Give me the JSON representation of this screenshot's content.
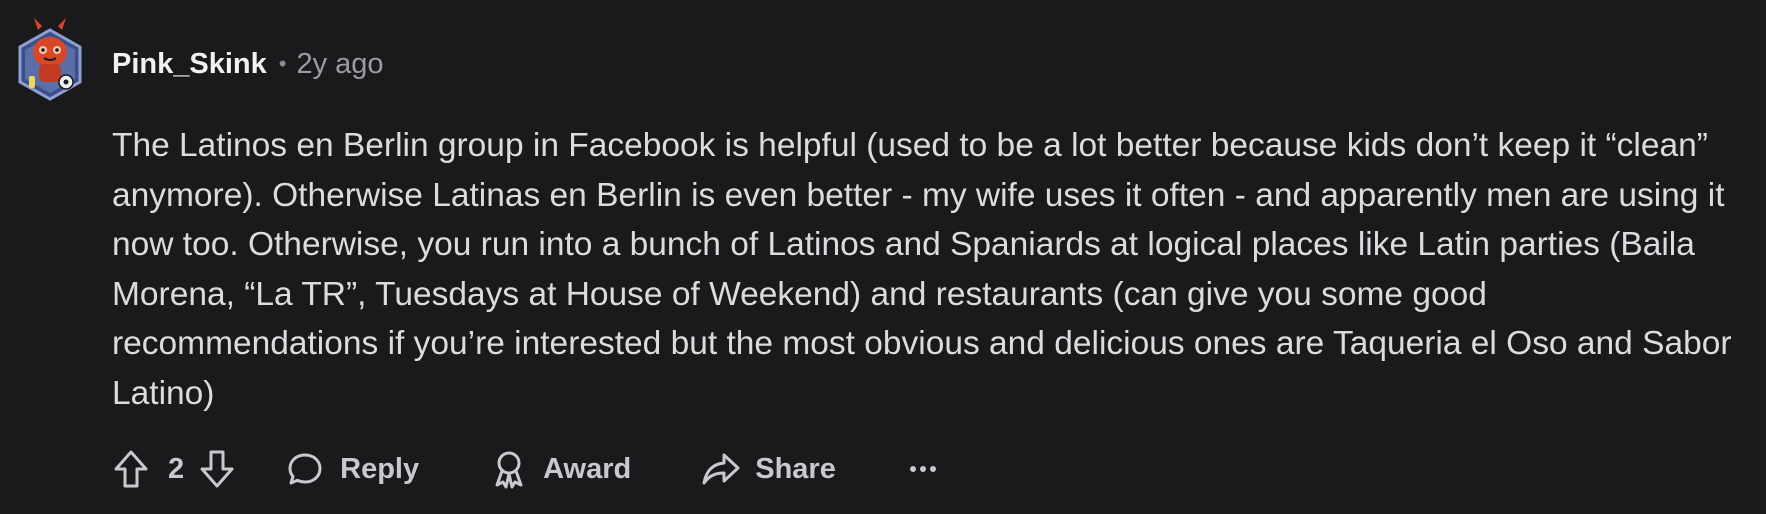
{
  "comment": {
    "author": "Pink_Skink",
    "separator": "•",
    "timestamp": "2y ago",
    "body": "The Latinos en Berlin group in Facebook is helpful (used to be a lot better because kids don’t keep it “clean” anymore). Otherwise Latinas en Berlin is even better - my wife uses it often - and apparently men are using it now too. Otherwise, you run into a bunch of Latinos and Spaniards at logical places like Latin parties (Baila Morena, “La TR”, Tuesdays at House of Weekend) and restaurants (can give you some good recommendations if you’re interested but the most obvious and delicious ones are Taqueria el Oso and Sabor Latino)"
  },
  "actions": {
    "upvote_icon": "arrow-up-outline-icon",
    "vote_count": "2",
    "downvote_icon": "arrow-down-outline-icon",
    "reply_icon": "speech-bubble-icon",
    "reply_label": "Reply",
    "award_icon": "award-ribbon-icon",
    "award_label": "Award",
    "share_icon": "share-arrow-icon",
    "share_label": "Share",
    "more_icon": "ellipsis-icon"
  },
  "colors": {
    "background": "#1a1a1d",
    "text_primary": "#f2f2f3",
    "text_body": "#dcdcdf",
    "text_muted": "#9b9ca1",
    "avatar_frame": "#5a6fa8",
    "avatar_character": "#d9472b"
  }
}
